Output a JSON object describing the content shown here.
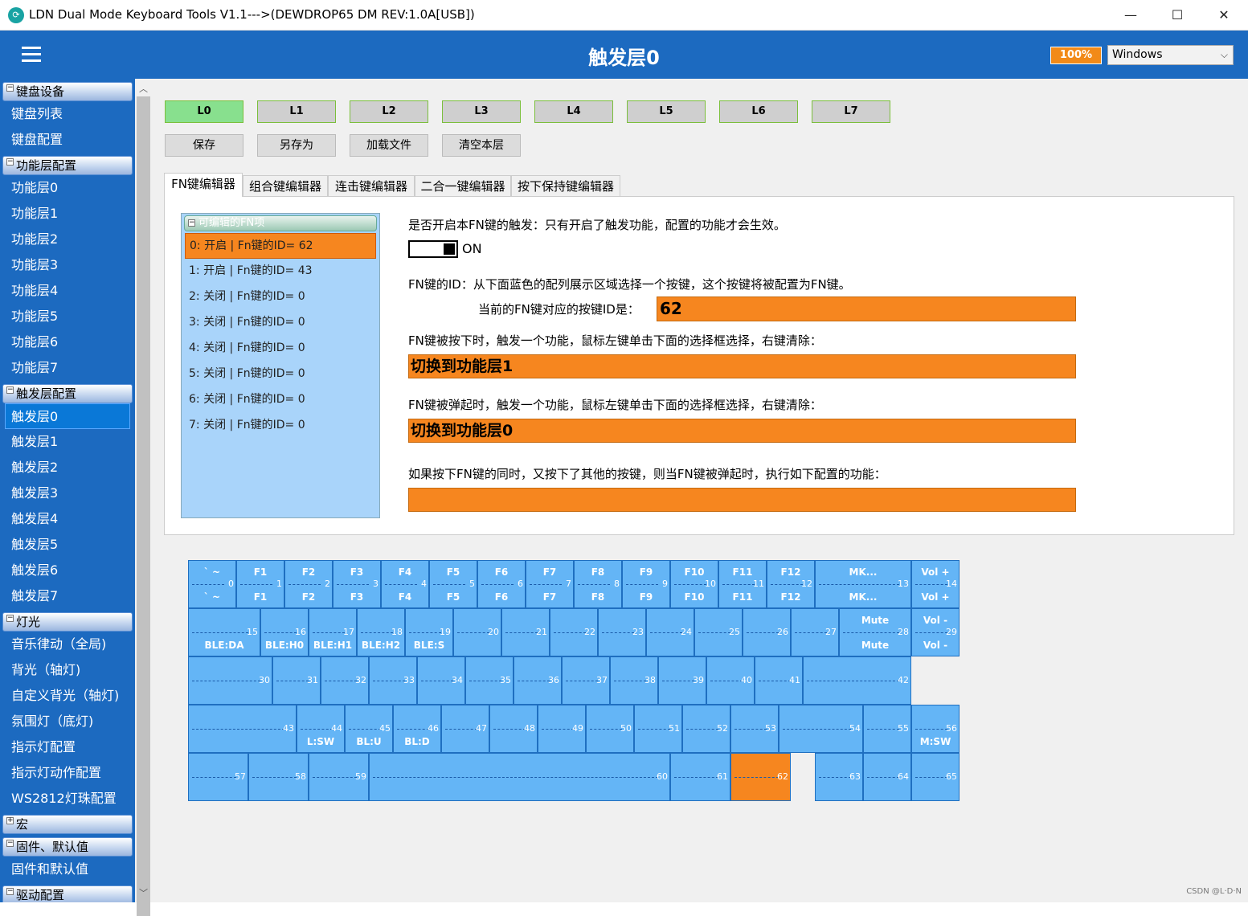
{
  "window": {
    "title": "LDN Dual Mode Keyboard Tools V1.1--->(DEWDROP65 DM REV:1.0A[USB])",
    "minimize": "—",
    "maximize": "☐",
    "close": "✕"
  },
  "header": {
    "page_title": "触发层0",
    "battery": "100%",
    "os_value": "Windows"
  },
  "sidebar": {
    "sections": [
      {
        "label": "键盘设备",
        "toggle": "−",
        "items": [
          "键盘列表",
          "键盘配置"
        ]
      },
      {
        "label": "功能层配置",
        "toggle": "−",
        "items": [
          "功能层0",
          "功能层1",
          "功能层2",
          "功能层3",
          "功能层4",
          "功能层5",
          "功能层6",
          "功能层7"
        ]
      },
      {
        "label": "触发层配置",
        "toggle": "−",
        "items": [
          "触发层0",
          "触发层1",
          "触发层2",
          "触发层3",
          "触发层4",
          "触发层5",
          "触发层6",
          "触发层7"
        ]
      },
      {
        "label": "灯光",
        "toggle": "−",
        "items": [
          "音乐律动（全局)",
          "背光（轴灯)",
          "自定义背光（轴灯)",
          "氛围灯（底灯)",
          "指示灯配置",
          "指示灯动作配置",
          "WS2812灯珠配置"
        ]
      },
      {
        "label": "宏",
        "toggle": "+",
        "items": []
      },
      {
        "label": "固件、默认值",
        "toggle": "−",
        "items": [
          "固件和默认值"
        ]
      },
      {
        "label": "驱动配置",
        "toggle": "−",
        "items": []
      }
    ],
    "active_item": "触发层0"
  },
  "layers": [
    "L0",
    "L1",
    "L2",
    "L3",
    "L4",
    "L5",
    "L6",
    "L7"
  ],
  "actions": [
    "保存",
    "另存为",
    "加载文件",
    "清空本层"
  ],
  "tabs": [
    "FN键编辑器",
    "组合键编辑器",
    "连击键编辑器",
    "二合一键编辑器",
    "按下保持键编辑器"
  ],
  "fn_list": {
    "header": "可编辑的FN项",
    "toggle": "−",
    "rows": [
      "0: 开启 | Fn键的ID= 62",
      "1: 开启 | Fn键的ID= 43",
      "2: 关闭 | Fn键的ID= 0",
      "3: 关闭 | Fn键的ID= 0",
      "4: 关闭 | Fn键的ID= 0",
      "5: 关闭 | Fn键的ID= 0",
      "6: 关闭 | Fn键的ID= 0",
      "7: 关闭 | Fn键的ID= 0"
    ]
  },
  "editor": {
    "enable_label": "是否开启本FN键的触发：只有开启了触发功能，配置的功能才会生效。",
    "toggle_state": "ON",
    "id_label": "FN键的ID：从下面蓝色的配列展示区域选择一个按键，这个按键将被配置为FN键。",
    "current_id_label": "当前的FN键对应的按键ID是：",
    "current_id": "62",
    "press_label": "FN键被按下时，触发一个功能，鼠标左键单击下面的选择框选择，右键清除：",
    "press_value": "切换到功能层1",
    "release_label": "FN键被弹起时，触发一个功能，鼠标左键单击下面的选择框选择，右键清除：",
    "release_value": "切换到功能层0",
    "combo_label": "如果按下FN键的同时，又按下了其他的按键，则当FN键被弹起时，执行如下配置的功能：",
    "combo_value": ""
  },
  "keyboard_keys": [
    {
      "id": "0",
      "top": "` ~",
      "bot": "` ~"
    },
    {
      "id": "1",
      "top": "F1",
      "bot": "F1"
    },
    {
      "id": "2",
      "top": "F2",
      "bot": "F2"
    },
    {
      "id": "3",
      "top": "F3",
      "bot": "F3"
    },
    {
      "id": "4",
      "top": "F4",
      "bot": "F4"
    },
    {
      "id": "5",
      "top": "F5",
      "bot": "F5"
    },
    {
      "id": "6",
      "top": "F6",
      "bot": "F6"
    },
    {
      "id": "7",
      "top": "F7",
      "bot": "F7"
    },
    {
      "id": "8",
      "top": "F8",
      "bot": "F8"
    },
    {
      "id": "9",
      "top": "F9",
      "bot": "F9"
    },
    {
      "id": "10",
      "top": "F10",
      "bot": "F10"
    },
    {
      "id": "11",
      "top": "F11",
      "bot": "F11"
    },
    {
      "id": "12",
      "top": "F12",
      "bot": "F12"
    },
    {
      "id": "13",
      "top": "MK...",
      "bot": "MK..."
    },
    {
      "id": "14",
      "top": "Vol +",
      "bot": "Vol +"
    },
    {
      "id": "15",
      "top": "",
      "bot": "BLE:DA"
    },
    {
      "id": "16",
      "top": "",
      "bot": "BLE:H0"
    },
    {
      "id": "17",
      "top": "",
      "bot": "BLE:H1"
    },
    {
      "id": "18",
      "top": "",
      "bot": "BLE:H2"
    },
    {
      "id": "19",
      "top": "",
      "bot": "BLE:S"
    },
    {
      "id": "20",
      "top": "",
      "bot": ""
    },
    {
      "id": "21",
      "top": "",
      "bot": ""
    },
    {
      "id": "22",
      "top": "",
      "bot": ""
    },
    {
      "id": "23",
      "top": "",
      "bot": ""
    },
    {
      "id": "24",
      "top": "",
      "bot": ""
    },
    {
      "id": "25",
      "top": "",
      "bot": ""
    },
    {
      "id": "26",
      "top": "",
      "bot": ""
    },
    {
      "id": "27",
      "top": "",
      "bot": ""
    },
    {
      "id": "28",
      "top": "Mute",
      "bot": "Mute"
    },
    {
      "id": "29",
      "top": "Vol -",
      "bot": "Vol -"
    },
    {
      "id": "30",
      "top": "",
      "bot": ""
    },
    {
      "id": "31",
      "top": "",
      "bot": ""
    },
    {
      "id": "32",
      "top": "",
      "bot": ""
    },
    {
      "id": "33",
      "top": "",
      "bot": ""
    },
    {
      "id": "34",
      "top": "",
      "bot": ""
    },
    {
      "id": "35",
      "top": "",
      "bot": ""
    },
    {
      "id": "36",
      "top": "",
      "bot": ""
    },
    {
      "id": "37",
      "top": "",
      "bot": ""
    },
    {
      "id": "38",
      "top": "",
      "bot": ""
    },
    {
      "id": "39",
      "top": "",
      "bot": ""
    },
    {
      "id": "40",
      "top": "",
      "bot": ""
    },
    {
      "id": "41",
      "top": "",
      "bot": ""
    },
    {
      "id": "42",
      "top": "",
      "bot": ""
    },
    {
      "id": "43",
      "top": "",
      "bot": ""
    },
    {
      "id": "44",
      "top": "",
      "bot": "L:SW"
    },
    {
      "id": "45",
      "top": "",
      "bot": "BL:U"
    },
    {
      "id": "46",
      "top": "",
      "bot": "BL:D"
    },
    {
      "id": "47",
      "top": "",
      "bot": ""
    },
    {
      "id": "48",
      "top": "",
      "bot": ""
    },
    {
      "id": "49",
      "top": "",
      "bot": ""
    },
    {
      "id": "50",
      "top": "",
      "bot": ""
    },
    {
      "id": "51",
      "top": "",
      "bot": ""
    },
    {
      "id": "52",
      "top": "",
      "bot": ""
    },
    {
      "id": "53",
      "top": "",
      "bot": ""
    },
    {
      "id": "54",
      "top": "",
      "bot": ""
    },
    {
      "id": "55",
      "top": "",
      "bot": ""
    },
    {
      "id": "56",
      "top": "",
      "bot": "M:SW"
    },
    {
      "id": "57",
      "top": "",
      "bot": ""
    },
    {
      "id": "58",
      "top": "",
      "bot": ""
    },
    {
      "id": "59",
      "top": "",
      "bot": ""
    },
    {
      "id": "60",
      "top": "",
      "bot": ""
    },
    {
      "id": "61",
      "top": "",
      "bot": ""
    },
    {
      "id": "62",
      "top": "",
      "bot": ""
    },
    {
      "id": "63",
      "top": "",
      "bot": ""
    },
    {
      "id": "64",
      "top": "",
      "bot": ""
    },
    {
      "id": "65",
      "top": "",
      "bot": ""
    }
  ],
  "selected_key": "62",
  "colors": {
    "header": "#1c6ac0",
    "accent": "#f6861f",
    "key": "#64b5f6",
    "layer_active": "#88e08e"
  },
  "watermark": "CSDN @L·D·N"
}
